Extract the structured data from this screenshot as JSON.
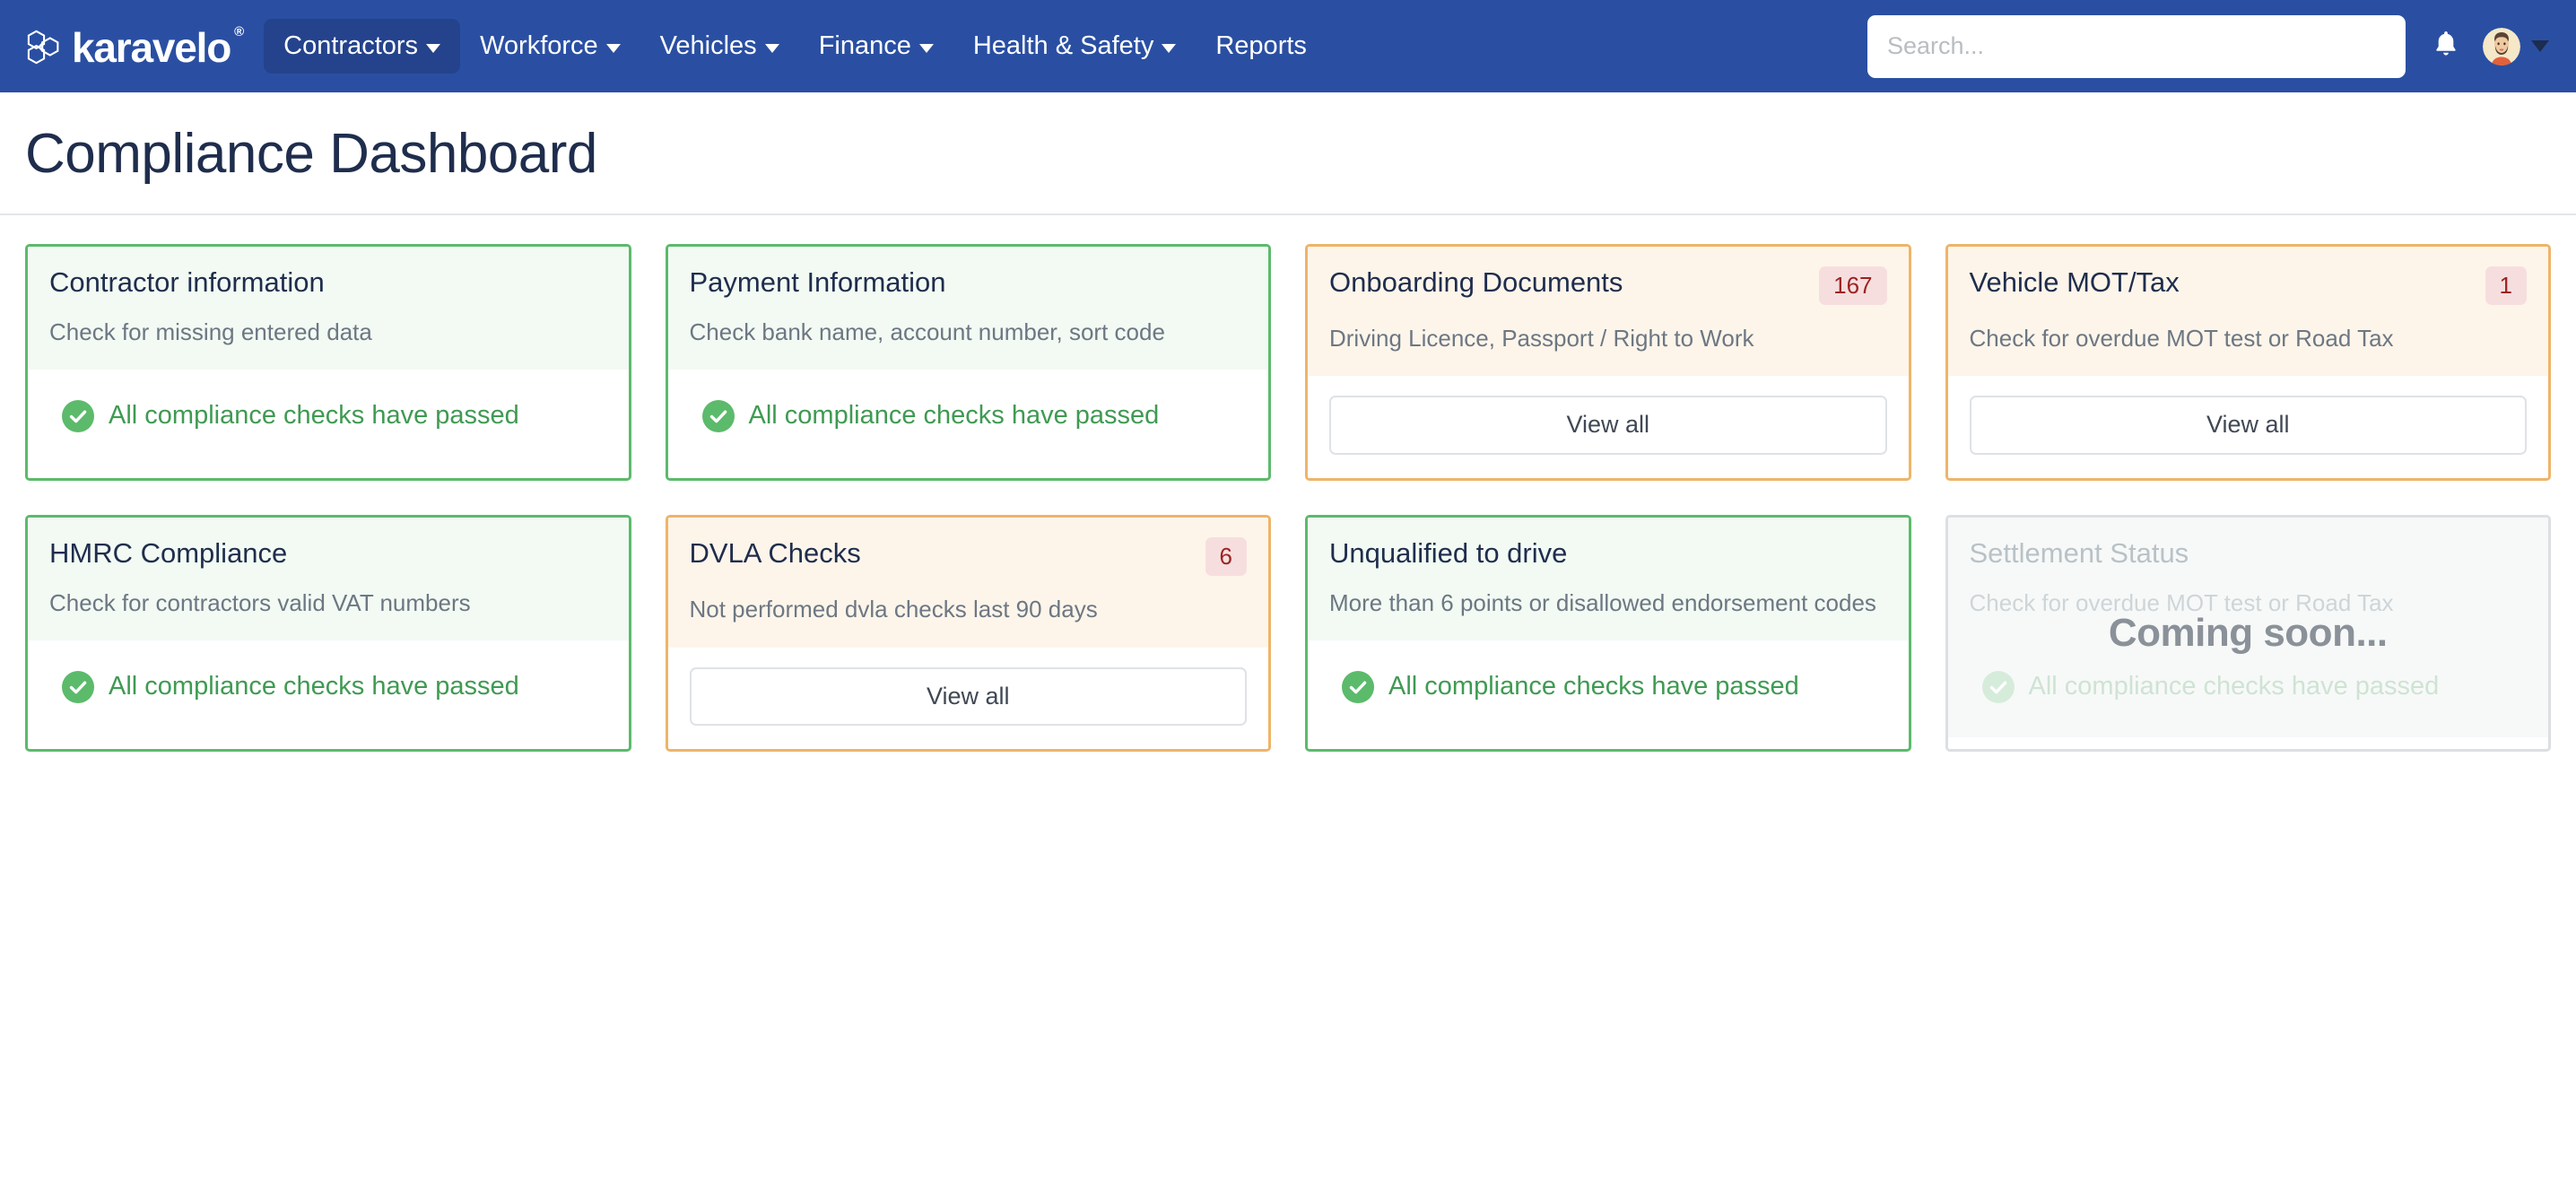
{
  "navbar": {
    "brand_name": "karavelo",
    "brand_registered_mark": "®",
    "brand_logo_icon": "hexagon-cluster-logo-icon",
    "menu_items": [
      {
        "label": "Contractors",
        "has_dropdown": true,
        "active": true
      },
      {
        "label": "Workforce",
        "has_dropdown": true,
        "active": false
      },
      {
        "label": "Vehicles",
        "has_dropdown": true,
        "active": false
      },
      {
        "label": "Finance",
        "has_dropdown": true,
        "active": false
      },
      {
        "label": "Health & Safety",
        "has_dropdown": true,
        "active": false
      },
      {
        "label": "Reports",
        "has_dropdown": false,
        "active": false
      }
    ],
    "search": {
      "placeholder": "Search...",
      "value": ""
    },
    "notification_icon": "bell-icon",
    "avatar_icon": "user-avatar-icon",
    "avatar_caret_icon": "chevron-down-icon",
    "background_color": "#2a4fa2",
    "active_item_color": "#24438c"
  },
  "page": {
    "title": "Compliance Dashboard"
  },
  "colors": {
    "ok_border": "#5cba6b",
    "ok_header_bg": "#f2faf3",
    "ok_text": "#3f9a52",
    "warn_border": "#eeb469",
    "warn_header_bg": "#fdf5ea",
    "badge_bg": "#f7dede",
    "badge_text": "#9a2424",
    "disabled_border": "#dcdfe3",
    "title_text": "#1f2d4d",
    "subtitle_text": "#6d7783"
  },
  "labels": {
    "view_all": "View all",
    "coming_soon": "Coming soon..."
  },
  "cards": [
    {
      "id": "contractor-information",
      "title": "Contractor information",
      "subtitle": "Check for missing entered data",
      "state": "ok",
      "badge": null,
      "status_text": "All compliance checks have passed",
      "status_icon": "check-circle-icon",
      "action": null
    },
    {
      "id": "payment-information",
      "title": "Payment Information",
      "subtitle": "Check bank name, account number, sort code",
      "state": "ok",
      "badge": null,
      "status_text": "All compliance checks have passed",
      "status_icon": "check-circle-icon",
      "action": null
    },
    {
      "id": "onboarding-documents",
      "title": "Onboarding Documents",
      "subtitle": "Driving Licence, Passport / Right to Work",
      "state": "warn",
      "badge": "167",
      "status_text": null,
      "status_icon": null,
      "action": "View all"
    },
    {
      "id": "vehicle-mot-tax",
      "title": "Vehicle MOT/Tax",
      "subtitle": "Check for overdue MOT test or Road Tax",
      "state": "warn",
      "badge": "1",
      "status_text": null,
      "status_icon": null,
      "action": "View all"
    },
    {
      "id": "hmrc-compliance",
      "title": "HMRC Compliance",
      "subtitle": "Check for contractors valid VAT numbers",
      "state": "ok",
      "badge": null,
      "status_text": "All compliance checks have passed",
      "status_icon": "check-circle-icon",
      "action": null
    },
    {
      "id": "dvla-checks",
      "title": "DVLA Checks",
      "subtitle": "Not performed dvla checks last 90 days",
      "state": "warn",
      "badge": "6",
      "status_text": null,
      "status_icon": null,
      "action": "View all"
    },
    {
      "id": "unqualified-to-drive",
      "title": "Unqualified to drive",
      "subtitle": "More than 6 points or disallowed endorsement codes",
      "state": "ok",
      "badge": null,
      "status_text": "All compliance checks have passed",
      "status_icon": "check-circle-icon",
      "action": null
    },
    {
      "id": "settlement-status",
      "title": "Settlement Status",
      "subtitle": "Check for overdue MOT test or Road Tax",
      "state": "off",
      "badge": null,
      "status_text": "All compliance checks have passed",
      "status_icon": "check-circle-icon",
      "action": null,
      "overlay": "Coming soon..."
    }
  ]
}
